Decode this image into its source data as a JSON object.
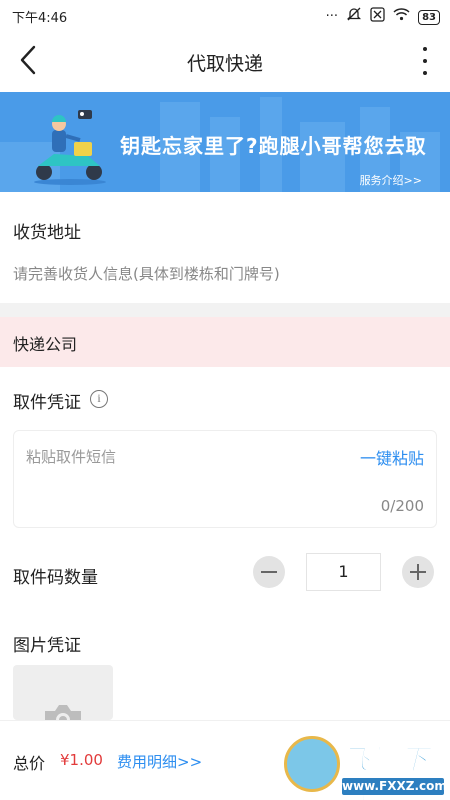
{
  "status_bar": {
    "time": "下午4:46",
    "battery": "83",
    "icons": [
      "signal-dots-icon",
      "mute-icon",
      "sim-off-icon",
      "wifi-icon",
      "battery-icon"
    ]
  },
  "nav": {
    "title": "代取快递",
    "back_icon": "chevron-left-icon",
    "more_icon": "more-vertical-icon"
  },
  "banner": {
    "slogan": "钥匙忘家里了?跑腿小哥帮您去取",
    "link": "服务介绍>>"
  },
  "address": {
    "title": "收货地址",
    "placeholder": "请完善收货人信息(具体到楼栋和门牌号)"
  },
  "company": {
    "label": "快递公司"
  },
  "voucher": {
    "title": "取件凭证",
    "info_icon": "i",
    "sms_placeholder": "粘贴取件短信",
    "paste_button": "一键粘贴",
    "counter": "0/200"
  },
  "code_count": {
    "label": "取件码数量",
    "value": "1"
  },
  "image_voucher": {
    "title": "图片凭证"
  },
  "footer": {
    "total_label": "总价",
    "price": "¥1.00",
    "fee_detail": "费用明细>>"
  },
  "watermark": {
    "text": "飞翔下载",
    "url": "www.FXXZ.com"
  },
  "colors": {
    "banner": "#4a9be8",
    "accent_blue": "#2d8ef0",
    "price_red": "#e23b3b",
    "highlight_row": "#fce9ea"
  }
}
